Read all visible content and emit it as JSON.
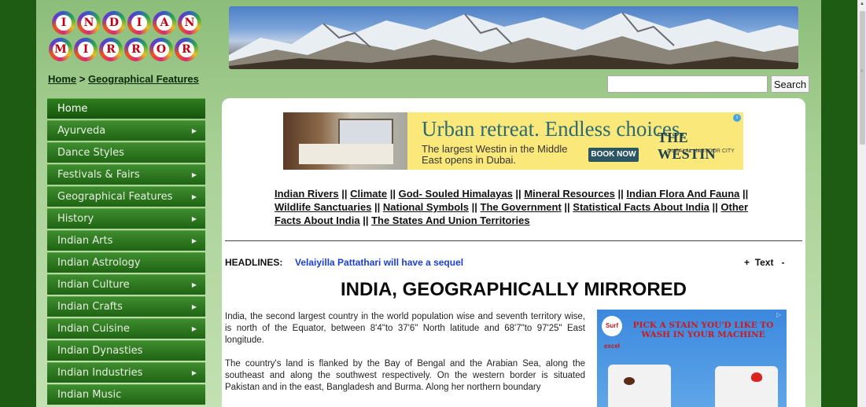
{
  "logo": {
    "row1": [
      "I",
      "N",
      "D",
      "I",
      "A",
      "N"
    ],
    "row2": [
      "M",
      "I",
      "R",
      "R",
      "O",
      "R"
    ]
  },
  "breadcrumb": {
    "home": "Home",
    "separator": ">",
    "current": "Geographical Features"
  },
  "search": {
    "value": "",
    "button_label": "Search"
  },
  "sidebar": {
    "items": [
      {
        "label": "Home",
        "has_submenu": false
      },
      {
        "label": "Ayurveda",
        "has_submenu": true
      },
      {
        "label": "Dance Styles",
        "has_submenu": false
      },
      {
        "label": "Festivals & Fairs",
        "has_submenu": true
      },
      {
        "label": "Geographical Features",
        "has_submenu": true
      },
      {
        "label": "History",
        "has_submenu": true
      },
      {
        "label": "Indian Arts",
        "has_submenu": true
      },
      {
        "label": "Indian Astrology",
        "has_submenu": false
      },
      {
        "label": "Indian Culture",
        "has_submenu": true
      },
      {
        "label": "Indian Crafts",
        "has_submenu": true
      },
      {
        "label": "Indian Cuisine",
        "has_submenu": true
      },
      {
        "label": "Indian Dynasties",
        "has_submenu": false
      },
      {
        "label": "Indian Industries",
        "has_submenu": true
      },
      {
        "label": "Indian Music",
        "has_submenu": false
      }
    ]
  },
  "ad_top": {
    "headline": "Urban retreat. Endless choices.",
    "subtext": "The largest Westin in the Middle East opens in Dubai.",
    "cta": "BOOK NOW",
    "brand": "THE WESTIN",
    "brand_sub": "DUBAI AL HABTOOR CITY",
    "info_icon": "i"
  },
  "topic_links": [
    "Indian Rivers",
    "Climate",
    "God- Souled Himalayas",
    "Mineral Resources",
    "Indian Flora And Fauna",
    "Wildlife Sanctuaries",
    "National Symbols",
    "The Government",
    "Statistical Facts About India",
    "Other Facts About India",
    "The States And Union Territories"
  ],
  "headlines": {
    "label": "HEADLINES:",
    "text": "Velaiyilla Pattathari will have a sequel"
  },
  "text_size": {
    "plus": "+",
    "label": "Text",
    "minus": "-"
  },
  "page_title": "INDIA, GEOGRAPHICALLY MIRRORED",
  "paragraphs": [
    "India, the second largest country in the world population wise and seventh territory wise, is north of the Equator, between 8'4\"to 37'6\" North latitude and 68'7\"to 97'25\" East longitude.",
    "The country's land is flanked by the Bay of Bengal and the Arabian Sea, along the southeast and along the southwest respectively. On the western border is situated Pakistan and in the east, Bangladesh and Burma. Along her northern boundary"
  ],
  "ad_right": {
    "logo": "Surf excel",
    "text": "PICK A STAIN YOU'D LIKE TO WASH IN YOUR MACHINE"
  },
  "colors": {
    "outer_bg": "#1e5c14",
    "nav_green": "#2f7d1f",
    "headline_blue": "#1a3fd8",
    "ad_yellow": "#fbe87a",
    "logo_red": "#c00010"
  }
}
